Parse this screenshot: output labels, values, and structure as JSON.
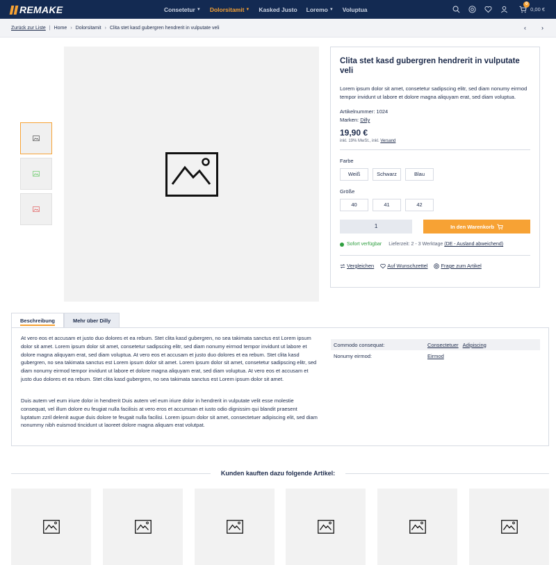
{
  "header": {
    "logo": "REMAKE",
    "nav": [
      {
        "label": "Consetetur",
        "dropdown": true,
        "active": false
      },
      {
        "label": "Dolorsitamit",
        "dropdown": true,
        "active": true
      },
      {
        "label": "Kasked Justo",
        "dropdown": false,
        "active": false
      },
      {
        "label": "Loremo",
        "dropdown": true,
        "active": false
      },
      {
        "label": "Voluptua",
        "dropdown": false,
        "active": false
      }
    ],
    "icons": [
      "search-icon",
      "help-icon",
      "heart-icon",
      "user-icon",
      "cart-icon"
    ],
    "cart_count": "0",
    "cart_total": "0,00 €",
    "accent_color": "#f7a234",
    "bar_color": "#132a52"
  },
  "breadcrumb": {
    "back": "Zurück zur Liste",
    "items": [
      "Home",
      "Dolorsitamit",
      "Clita stet kasd gubergren hendrerit in vulputate veli"
    ]
  },
  "product": {
    "title": "Clita stet kasd gubergren hendrerit in vulputate veli",
    "description": "Lorem ipsum dolor sit amet, consetetur sadipscing elitr, sed diam nonumy eirmod tempor invidunt ut labore et dolore magna aliquyam erat, sed diam voluptua.",
    "sku_label": "Artikelnummer:",
    "sku": "1024",
    "brand_label": "Marken:",
    "brand": "Dilly",
    "price": "19,90 €",
    "tax_text": "inkl. 19% MwSt., inkl.",
    "tax_link": "Versand",
    "color_label": "Farbe",
    "colors": [
      "Weiß",
      "Schwarz",
      "Blau"
    ],
    "size_label": "Größe",
    "sizes": [
      "40",
      "41",
      "42"
    ],
    "quantity": "1",
    "add_to_cart": "In den Warenkorb",
    "availability": "Sofort verfügbar",
    "delivery": "Lieferzeit: 2 - 3 Werktage",
    "delivery_link": "(DE - Ausland abweichend)",
    "actions": [
      "Vergleichen",
      "Auf Wunschzettel",
      "Frage zum Artikel"
    ]
  },
  "tabs": {
    "items": [
      "Beschreibung",
      "Mehr über Dilly"
    ],
    "paragraph_1": "At vero eos et accusam et justo duo dolores et ea rebum. Stet clita kasd gubergren, no sea takimata sanctus est Lorem ipsum dolor sit amet. Lorem ipsum dolor sit amet, consetetur sadipscing elitr, sed diam nonumy eirmod tempor invidunt ut labore et dolore magna aliquyam erat, sed diam voluptua. At vero eos et accusam et justo duo dolores et ea rebum. Stet clita kasd gubergren, no sea takimata sanctus est Lorem ipsum dolor sit amet. Lorem ipsum dolor sit amet, consetetur sadipscing elitr, sed diam nonumy eirmod tempor invidunt ut labore et dolore magna aliquyam erat, sed diam voluptua. At vero eos et accusam et justo duo dolores et ea rebum. Stet clita kasd gubergren, no sea takimata sanctus est Lorem ipsum dolor sit amet.",
    "paragraph_2": "Duis autem vel eum iriure dolor in hendrerit Duis autem vel eum iriure dolor in hendrerit in vulputate velit esse molestie consequat, vel illum dolore eu feugiat nulla facilisis at vero eros et accumsan et iusto odio dignissim qui blandit praesent luptatum zzril delenit augue duis dolore te feugait nulla facilisi. Lorem ipsum dolor sit amet, consectetuer adipiscing elit, sed diam nonummy nibh euismod tincidunt ut laoreet dolore magna aliquam erat volutpat.",
    "properties": [
      {
        "key": "Commodo consequat:",
        "values": [
          "Consectetuer",
          "Adipiscing"
        ]
      },
      {
        "key": "Nonumy eirmod:",
        "values": [
          "Eirmod"
        ]
      }
    ]
  },
  "cross_selling": {
    "title": "Kunden kauften dazu folgende Artikel:"
  }
}
